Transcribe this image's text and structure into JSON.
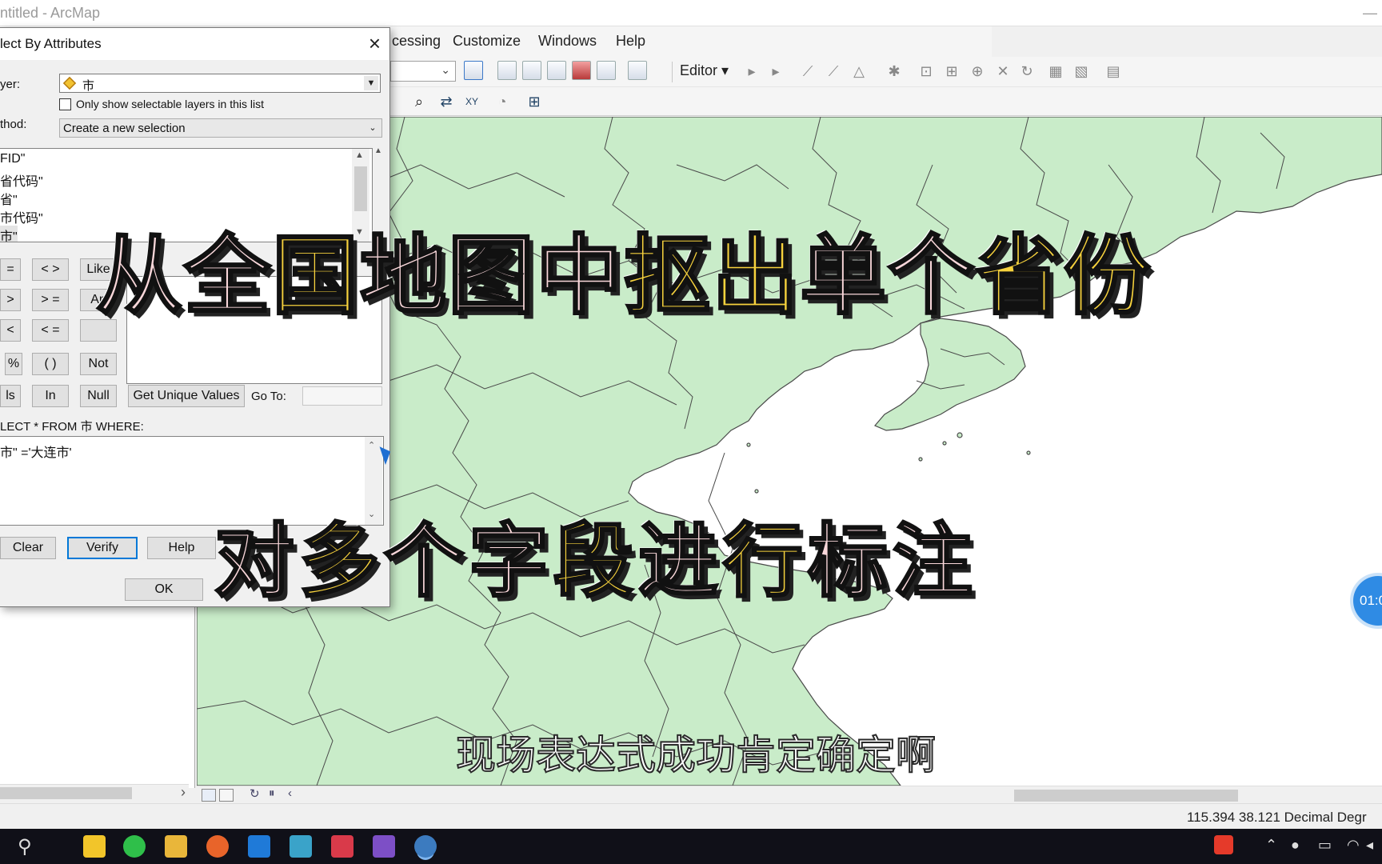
{
  "window": {
    "title": "Untitled - ArcMap",
    "title_visible": "ntitled - ArcMap"
  },
  "menubar": {
    "items": [
      "cessing",
      "Customize",
      "Windows",
      "Help"
    ]
  },
  "toolbar": {
    "editor_label": "Editor ▾"
  },
  "dialog": {
    "title": "lect By Attributes",
    "layer_label": "yer:",
    "layer_value": "市",
    "only_selectable_label": "Only show selectable layers in this list",
    "method_label": "thod:",
    "method_value": "Create a new selection",
    "fields": [
      "FID\"",
      "省代码\"",
      "省\"",
      "市代码\"",
      "市\""
    ],
    "operators": {
      "eq": "=",
      "neq": "< >",
      "like": "Like",
      "gt": ">",
      "gte": "> =",
      "and": "An",
      "lt": "<",
      "lte": "< =",
      "pct": "%",
      "paren": "( )",
      "not": "Not",
      "is": "ls",
      "in": "In",
      "null": "Null"
    },
    "get_unique_values": "Get Unique Values",
    "goto_label": "Go To:",
    "sql_label": "LECT * FROM 市 WHERE:",
    "sql_expression": "市\" ='大连市'",
    "buttons": {
      "clear": "Clear",
      "verify": "Verify",
      "help": "Help",
      "ok": "OK"
    }
  },
  "overlay": {
    "line1": [
      {
        "t": "从全",
        "c": "pk"
      },
      {
        "t": "国",
        "c": "yl"
      },
      {
        "t": "地图",
        "c": "pk"
      },
      {
        "t": "中",
        "c": "pk"
      },
      {
        "t": "抠出",
        "c": "yl"
      },
      {
        "t": "单个",
        "c": "pk"
      },
      {
        "t": "省份",
        "c": "yl"
      }
    ],
    "line2": [
      {
        "t": "对",
        "c": "pk"
      },
      {
        "t": "多",
        "c": "yl"
      },
      {
        "t": "个字",
        "c": "pk"
      },
      {
        "t": "段",
        "c": "yl"
      },
      {
        "t": "进",
        "c": "pk"
      },
      {
        "t": "行",
        "c": "yl"
      },
      {
        "t": "标注",
        "c": "pk"
      }
    ],
    "subtitle": "现场表达式成功肯定确定啊",
    "timer": "01:0"
  },
  "status": {
    "coords": "115.394  38.121 Decimal Degr"
  },
  "colors": {
    "map_fill": "#c9ecc9",
    "map_stroke": "#4a4a4a",
    "sea": "#ffffff",
    "accent": "#0078d7"
  }
}
